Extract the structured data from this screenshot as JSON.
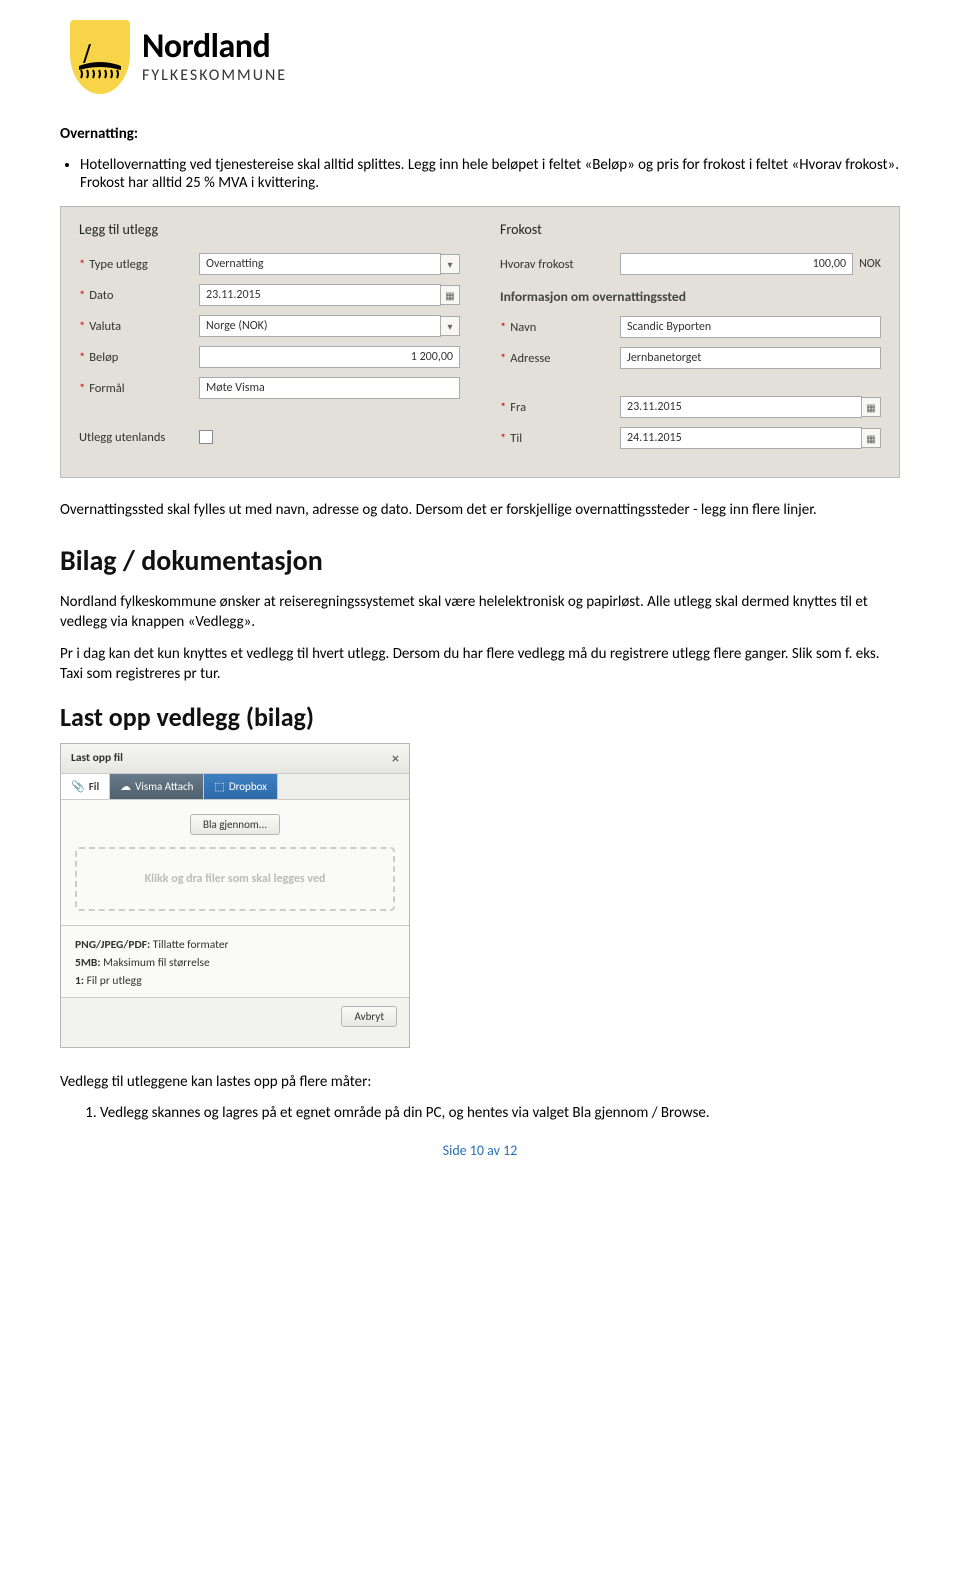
{
  "brand": {
    "name": "Nordland",
    "sub": "FYLKESKOMMUNE"
  },
  "intro": {
    "heading": "Overnatting:",
    "bullet": "Hotellovernatting ved tjenestereise skal alltid splittes. Legg inn hele beløpet i feltet «Beløp» og pris for frokost i feltet «Hvorav frokost». Frokost har alltid 25 % MVA i kvittering."
  },
  "form": {
    "left": {
      "title": "Legg til utlegg",
      "rows": {
        "type": {
          "label": "Type utlegg",
          "value": "Overnatting"
        },
        "dato": {
          "label": "Dato",
          "value": "23.11.2015"
        },
        "valuta": {
          "label": "Valuta",
          "value": "Norge (NOK)"
        },
        "belop": {
          "label": "Beløp",
          "value": "1 200,00"
        },
        "formal": {
          "label": "Formål",
          "value": "Møte Visma"
        },
        "utenlands": {
          "label": "Utlegg utenlands"
        }
      }
    },
    "right": {
      "title": "Frokost",
      "frokost": {
        "label": "Hvorav frokost",
        "value": "100,00",
        "suffix": "NOK"
      },
      "subhead": "Informasjon om overnattingssted",
      "navn": {
        "label": "Navn",
        "value": "Scandic Byporten"
      },
      "adresse": {
        "label": "Adresse",
        "value": "Jernbanetorget"
      },
      "fra": {
        "label": "Fra",
        "value": "23.11.2015"
      },
      "til": {
        "label": "Til",
        "value": "24.11.2015"
      }
    }
  },
  "after_form": "Overnattingssted skal fylles ut med navn, adresse og dato. Dersom det er forskjellige overnattingssteder - legg inn flere linjer.",
  "sec_bilag": {
    "h": "Bilag / dokumentasjon",
    "p1": "Nordland fylkeskommune ønsker at reiseregningssystemet skal være helelektronisk og papirløst. Alle utlegg skal dermed knyttes til et vedlegg via knappen «Vedlegg».",
    "p2": "Pr i dag kan det kun knyttes et vedlegg til hvert utlegg. Dersom du har flere vedlegg må du registrere utlegg flere ganger. Slik som f. eks. Taxi som registreres pr tur."
  },
  "sec_upload": {
    "h": "Last opp vedlegg (bilag)"
  },
  "upload": {
    "title": "Last opp fil",
    "tabs": {
      "fil": "Fil",
      "visma": "Visma Attach",
      "dropbox": "Dropbox"
    },
    "browse": "Bla gjennom...",
    "dropzone": "Klikk og dra filer som skal legges ved",
    "info": {
      "l1a": "PNG/JPEG/PDF:",
      "l1b": " Tillatte formater",
      "l2a": "5MB:",
      "l2b": " Maksimum fil størrelse",
      "l3a": "1:",
      "l3b": " Fil pr utlegg"
    },
    "cancel": "Avbryt"
  },
  "after_upload": {
    "p": "Vedlegg til utleggene kan lastes opp på flere måter:",
    "li": "Vedlegg skannes og lagres på et egnet område på din PC, og hentes via valget Bla gjennom / Browse."
  },
  "footer": "Side 10 av 12"
}
